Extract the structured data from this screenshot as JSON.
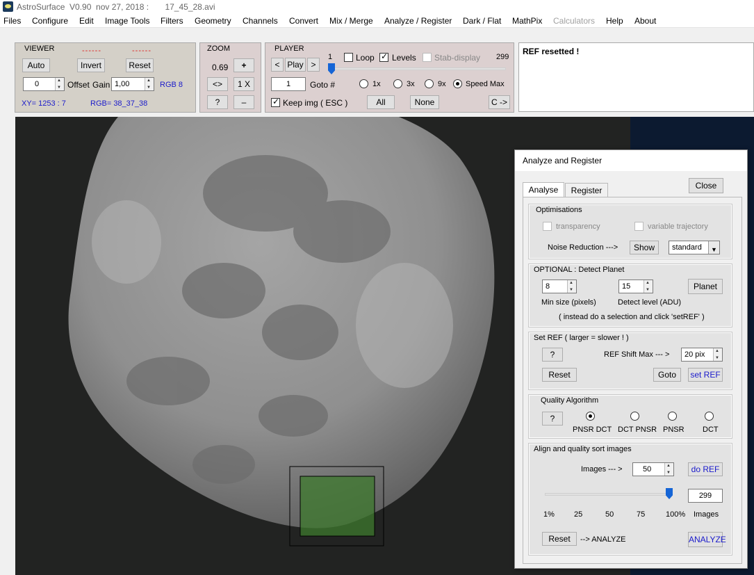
{
  "window": {
    "title": "AstroSurface  V0.90  nov 27, 2018 :       17_45_28.avi"
  },
  "menu": [
    "Files",
    "Configure",
    "Edit",
    "Image Tools",
    "Filters",
    "Geometry",
    "Channels",
    "Convert",
    "Mix / Merge",
    "Analyze / Register",
    "Dark / Flat",
    "MathPix",
    "Calculators",
    "Help",
    "About"
  ],
  "menu_disabled": "Calculators",
  "viewer": {
    "title": "VIEWER",
    "dash1": "------",
    "dash2": "------",
    "auto": "Auto",
    "invert": "Invert",
    "reset": "Reset",
    "offset_value": "0",
    "offset_label": "Offset",
    "gain_label": "Gain",
    "gain_value": "1,00",
    "rgb_mode": "RGB 8",
    "xy": "XY=  1253 : 7",
    "rgb": "RGB=  38_37_38"
  },
  "zoom": {
    "title": "ZOOM",
    "value": "0.69",
    "plus": "+",
    "fit": "<>",
    "one": "1 X",
    "help": "?",
    "minus": "–"
  },
  "player": {
    "title": "PLAYER",
    "prev": "<",
    "play": "Play",
    "next": ">",
    "frame_start": "1",
    "frame_end": "299",
    "slider_fraction": 0.0,
    "loop": "Loop",
    "levels": "Levels",
    "stab": "Stab-display",
    "goto_value": "1",
    "goto_label": "Goto #",
    "speed_1x": "1x",
    "speed_3x": "3x",
    "speed_9x": "9x",
    "speed_max": "Speed Max",
    "keep": "Keep img ( ESC )",
    "all": "All",
    "none": "None",
    "copy": "C ->"
  },
  "status": {
    "message": "REF resetted !"
  },
  "dialog": {
    "title": "Analyze and Register",
    "tab_analyse": "Analyse",
    "tab_register": "Register",
    "close": "Close",
    "optimisations": {
      "title": "Optimisations",
      "transparency": "transparency",
      "variable": "variable trajectory",
      "noise_label": "Noise Reduction   --->",
      "show": "Show",
      "noise_value": "standard"
    },
    "detect": {
      "title": "OPTIONAL : Detect Planet",
      "min_value": "8",
      "level_value": "15",
      "planet": "Planet",
      "min_label": "Min size (pixels)",
      "level_label": "Detect level  (ADU)",
      "hint": "( instead do a selection and click 'setREF' )"
    },
    "setref": {
      "title": "Set REF  ( larger = slower ! )",
      "help": "?",
      "shift_label": "REF  Shift Max   --- >",
      "shift_value": "20 pix",
      "reset": "Reset",
      "goto": "Goto",
      "set": "set REF"
    },
    "quality": {
      "title": "Quality Algorithm",
      "help": "?",
      "opt1": "PNSR  DCT",
      "opt2": "DCT  PNSR",
      "opt3": "PNSR",
      "opt4": "DCT"
    },
    "align": {
      "title": "Align and quality sort images",
      "images_label": "Images  --- >",
      "images_value": "50",
      "do_ref": "do REF",
      "slider_fraction": 1.0,
      "count": "299",
      "ticks": [
        "1%",
        "25",
        "50",
        "75",
        "100%"
      ],
      "count_label": "Images",
      "reset": "Reset",
      "arrow_label": "--> ANALYZE",
      "analyze": "ANALYZE"
    }
  },
  "colors": {
    "link_blue": "#1a1acb",
    "accent_blue": "#1565d6",
    "selection_green": "#3d7a2e"
  }
}
